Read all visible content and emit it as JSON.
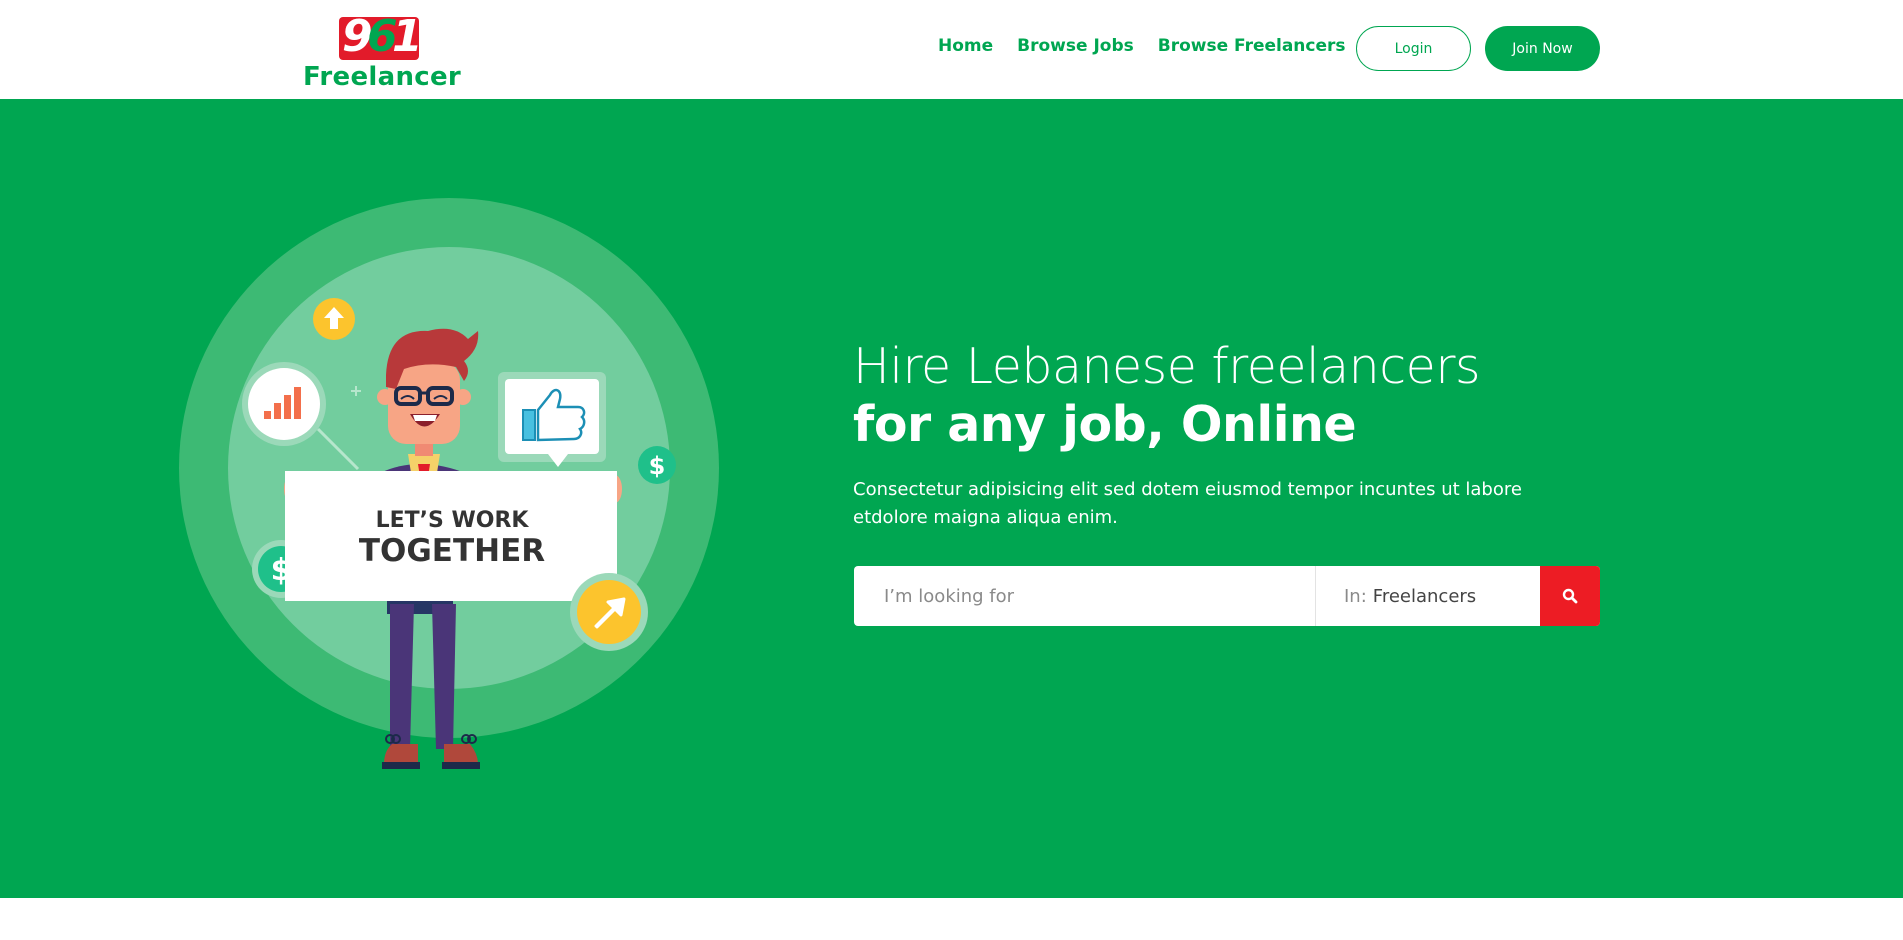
{
  "brand": {
    "logo_digits": [
      "9",
      "6",
      "1"
    ],
    "logo_word": "Freelancer",
    "colors": {
      "primary": "#00a651",
      "accent": "#ed1c24",
      "highlight": "#fcc42d"
    }
  },
  "nav": {
    "items": [
      {
        "label": "Home"
      },
      {
        "label": "Browse Jobs"
      },
      {
        "label": "Browse Freelancers"
      }
    ],
    "login_label": "Login",
    "join_label": "Join Now"
  },
  "hero": {
    "illustration": {
      "sign_line1": "LET’S WORK",
      "sign_line2": "TOGETHER",
      "icons": [
        "up-arrow-icon",
        "bar-chart-icon",
        "thumbs-up-icon",
        "dollar-icon",
        "dollar-icon",
        "arrow-up-right-icon"
      ]
    },
    "headline_line1": "Hire Lebanese freelancers",
    "headline_line2": "for any job, Online",
    "subtext": "Consectetur adipisicing elit sed dotem eiusmod tempor incuntes ut labore etdolore maigna aliqua enim.",
    "search": {
      "placeholder": "I’m looking for",
      "in_label": "In:",
      "in_value": "Freelancers",
      "button_icon": "search-icon"
    }
  }
}
